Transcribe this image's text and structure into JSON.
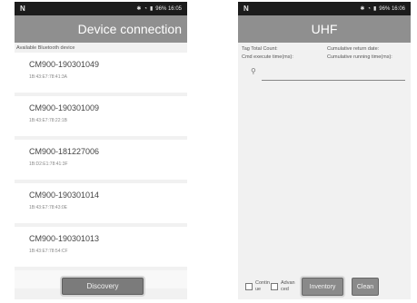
{
  "colors": {
    "statusbar": "#1c1c1c",
    "titlebar": "#8f8f8f",
    "background": "#f1f1f1",
    "button": "#7b7b7b"
  },
  "left_screen": {
    "status": {
      "left": "N",
      "right": "96% 16:05"
    },
    "title": "Device connection",
    "caption": "Available Bluetooth device",
    "devices": [
      {
        "name": "CM900-190301049",
        "sub": "1B:43:E7:78:41:3A"
      },
      {
        "name": "CM900-190301009",
        "sub": "1B:43:E7:78:22:1B"
      },
      {
        "name": "CM900-181227006",
        "sub": "1B:D2:E1:78:41:3F"
      },
      {
        "name": "CM900-190301014",
        "sub": "1B:43:E7:78:43:0E"
      },
      {
        "name": "CM900-190301013",
        "sub": "1B:43:E7:78:54:CF"
      }
    ],
    "discovery_label": "Discovery"
  },
  "right_screen": {
    "status": {
      "left": "N",
      "right": "96% 16:06"
    },
    "title": "UHF",
    "info": {
      "tag_total": "Tag Total Count:",
      "cumulative_return": "Cumulative return date:",
      "cmd_execute": "Cmd execute time(ms):",
      "cumulative_running": "Cumulative running time(ms):"
    },
    "search_placeholder": "",
    "continue_label": "Contin ue",
    "advanced_label": "Advan ced",
    "inventory_label": "Inventory",
    "clean_label": "Clean"
  },
  "icons": {
    "search": "search-icon",
    "bluetooth": "bluetooth-icon",
    "wifi": "wifi-icon",
    "battery": "battery-icon",
    "signal": "nfc-icon"
  }
}
